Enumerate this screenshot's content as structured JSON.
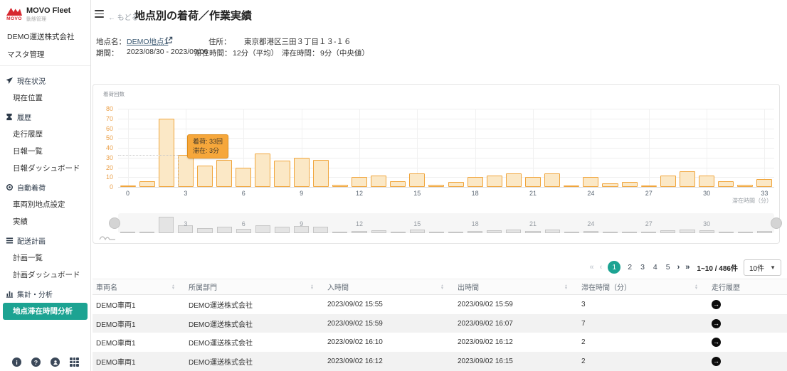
{
  "colors": {
    "accent": "#1CA392",
    "bar_fill": "#FBE8C6",
    "bar_border": "#F0A53C",
    "tooltip_bg": "#F6A73B"
  },
  "sidebar": {
    "logo": {
      "brand": "MOVO",
      "title": "MOVO Fleet",
      "subtitle": "動態管理"
    },
    "company": "DEMO運送株式会社",
    "master_item": "マスタ管理",
    "sections": [
      {
        "icon": "navigation-icon",
        "label": "現在状況",
        "items": [
          {
            "label": "現在位置",
            "active": false
          }
        ]
      },
      {
        "icon": "hourglass-icon",
        "label": "履歴",
        "items": [
          {
            "label": "走行履歴",
            "active": false
          },
          {
            "label": "日報一覧",
            "active": false
          },
          {
            "label": "日報ダッシュボード",
            "active": false
          }
        ]
      },
      {
        "icon": "gear-icon",
        "label": "自動着荷",
        "items": [
          {
            "label": "車両別地点設定",
            "active": false
          },
          {
            "label": "実績",
            "active": false
          }
        ]
      },
      {
        "icon": "list-icon",
        "label": "配送計画",
        "items": [
          {
            "label": "計画一覧",
            "active": false
          },
          {
            "label": "計画ダッシュボード",
            "active": false
          }
        ]
      },
      {
        "icon": "bar-chart-icon",
        "label": "集計・分析",
        "items": [
          {
            "label": "地点滞在時間分析",
            "active": true
          }
        ]
      }
    ],
    "footer_icons": [
      "info-icon",
      "help-icon",
      "user-icon",
      "apps-icon"
    ]
  },
  "header": {
    "back_label": "もどる",
    "title": "地点別の着荷／作業実績"
  },
  "info": {
    "location_label": "地点名：",
    "location_value": "DEMO地点1",
    "address_label": "住所：",
    "address_value": "東京都港区三田３丁目１３-１６",
    "period_label": "期間：",
    "period_value": "2023/08/30 - 2023/09/06",
    "stay_avg_label": "滞在時間：",
    "stay_avg_value": "12分（平均）",
    "stay_median_label": "滞在時間：",
    "stay_median_value": "9分（中央値）"
  },
  "chart_data": {
    "type": "bar",
    "title": "",
    "ylabel": "着荷回数",
    "xlabel": "滞在時間（分）",
    "x": [
      0,
      1,
      2,
      3,
      4,
      5,
      6,
      7,
      8,
      9,
      10,
      11,
      12,
      13,
      14,
      15,
      16,
      17,
      18,
      19,
      20,
      21,
      22,
      23,
      24,
      25,
      26,
      27,
      28,
      29,
      30,
      31,
      32,
      33
    ],
    "values": [
      1,
      6,
      70,
      33,
      22,
      28,
      20,
      34,
      27,
      30,
      28,
      2,
      10,
      12,
      6,
      14,
      2,
      5,
      10,
      12,
      14,
      10,
      14,
      0.5,
      10,
      4,
      5,
      0.5,
      12,
      16,
      12,
      6,
      2,
      8
    ],
    "ylim": [
      0,
      80
    ],
    "yticks": [
      0,
      10,
      20,
      30,
      40,
      50,
      60,
      70,
      80
    ],
    "xticks": [
      0,
      3,
      6,
      9,
      12,
      15,
      18,
      21,
      24,
      27,
      30,
      33
    ],
    "grid": true,
    "has_brush": true,
    "tooltip": {
      "bar_x": 3,
      "line1": "着荷: 33回",
      "line2": "滞在: 3分"
    }
  },
  "pagination": {
    "first": "«",
    "prev": "‹",
    "next": "›",
    "last": "»",
    "pages": [
      "1",
      "2",
      "3",
      "4",
      "5"
    ],
    "current_page": "1",
    "range_info": "1~10 / 486件",
    "page_size": "10件"
  },
  "table": {
    "columns": [
      {
        "label": "車両名",
        "sortable": true
      },
      {
        "label": "所属部門",
        "sortable": true
      },
      {
        "label": "入時間",
        "sortable": true
      },
      {
        "label": "出時間",
        "sortable": true
      },
      {
        "label": "滞在時間（分）",
        "sortable": true
      },
      {
        "label": "走行履歴",
        "sortable": false
      }
    ],
    "rows": [
      {
        "vehicle": "DEMO車両1",
        "department": "DEMO運送株式会社",
        "in_time": "2023/09/02 15:55",
        "out_time": "2023/09/02 15:59",
        "stay_minutes": "3",
        "history_icon": "arrow-circle-icon"
      },
      {
        "vehicle": "DEMO車両1",
        "department": "DEMO運送株式会社",
        "in_time": "2023/09/02 15:59",
        "out_time": "2023/09/02 16:07",
        "stay_minutes": "7",
        "history_icon": "arrow-circle-icon"
      },
      {
        "vehicle": "DEMO車両1",
        "department": "DEMO運送株式会社",
        "in_time": "2023/09/02 16:10",
        "out_time": "2023/09/02 16:12",
        "stay_minutes": "2",
        "history_icon": "arrow-circle-icon"
      },
      {
        "vehicle": "DEMO車両1",
        "department": "DEMO運送株式会社",
        "in_time": "2023/09/02 16:12",
        "out_time": "2023/09/02 16:15",
        "stay_minutes": "2",
        "history_icon": "arrow-circle-icon"
      }
    ]
  }
}
